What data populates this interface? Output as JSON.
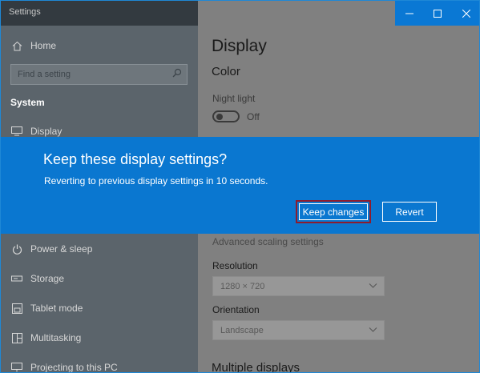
{
  "titlebar": {
    "title": "Settings",
    "minimize_icon": "minimize-icon",
    "maximize_icon": "maximize-icon",
    "close_icon": "close-icon"
  },
  "sidebar": {
    "home_label": "Home",
    "search_placeholder": "Find a setting",
    "section_title": "System",
    "items": [
      {
        "label": "Display",
        "icon": "monitor-icon"
      },
      {
        "label": "Power & sleep",
        "icon": "power-icon"
      },
      {
        "label": "Storage",
        "icon": "storage-icon"
      },
      {
        "label": "Tablet mode",
        "icon": "tablet-icon"
      },
      {
        "label": "Multitasking",
        "icon": "multitasking-icon"
      },
      {
        "label": "Projecting to this PC",
        "icon": "projecting-icon"
      }
    ]
  },
  "main": {
    "title": "Display",
    "color_heading": "Color",
    "night_light_label": "Night light",
    "night_light_state": "Off",
    "advanced_scaling_link": "Advanced scaling settings",
    "resolution_label": "Resolution",
    "resolution_value": "1280 × 720",
    "orientation_label": "Orientation",
    "orientation_value": "Landscape",
    "multiple_displays_heading": "Multiple displays"
  },
  "dialog": {
    "title": "Keep these display settings?",
    "message": "Reverting to previous display settings in 10 seconds.",
    "keep_button": "Keep changes",
    "revert_button": "Revert"
  },
  "colors": {
    "accent": "#0a77d0",
    "highlight_border": "#8c1c2e",
    "sidebar_bg": "#5b646b",
    "main_bg": "#808080"
  }
}
